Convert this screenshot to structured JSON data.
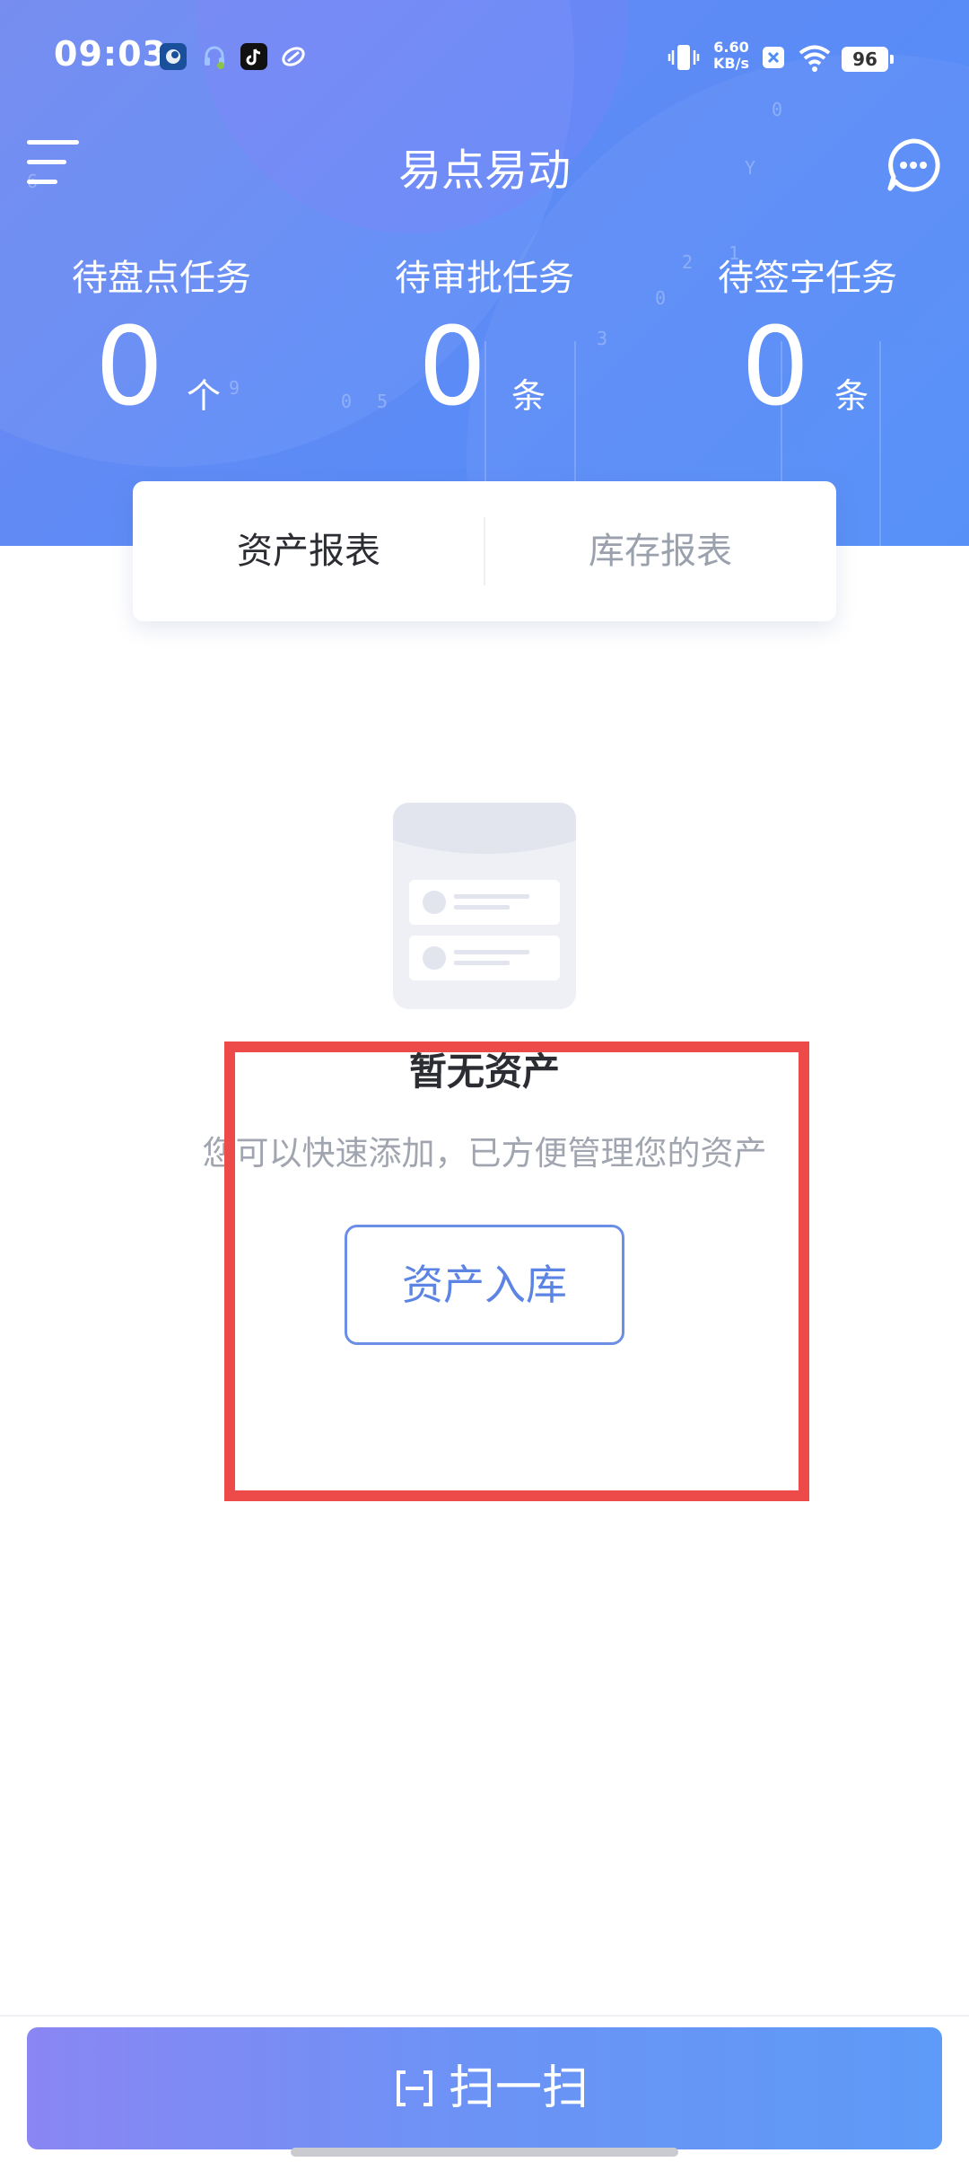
{
  "status_bar": {
    "time": "09:03",
    "net_speed_value": "6.60",
    "net_speed_unit": "KB/s",
    "battery": "96",
    "icons": [
      "app-blue-icon",
      "headset-icon",
      "tiktok-icon",
      "cloud-app-icon",
      "vibrate-icon",
      "sim-off-icon",
      "wifi-icon",
      "battery-icon"
    ]
  },
  "header": {
    "title": "易点易动",
    "menu_icon": "menu-icon",
    "chat_icon": "chat-bubble-icon"
  },
  "stats": [
    {
      "label": "待盘点任务",
      "value": "0",
      "unit": "个"
    },
    {
      "label": "待审批任务",
      "value": "0",
      "unit": "条"
    },
    {
      "label": "待签字任务",
      "value": "0",
      "unit": "条"
    }
  ],
  "tabs": [
    {
      "label": "资产报表",
      "active": true
    },
    {
      "label": "库存报表",
      "active": false
    }
  ],
  "empty_state": {
    "title": "暂无资产",
    "description": "您可以快速添加，已方便管理您的资产",
    "button_label": "资产入库"
  },
  "bottom": {
    "scan_label": "扫一扫",
    "scan_icon": "scan-icon"
  },
  "colors": {
    "header_gradient_start": "#6f86f0",
    "header_gradient_end": "#4f8cf8",
    "button_accent": "#5b84e4",
    "highlight_box": "#ec4b4a",
    "scan_gradient_start": "#8a86f4",
    "scan_gradient_end": "#5e9af7"
  }
}
